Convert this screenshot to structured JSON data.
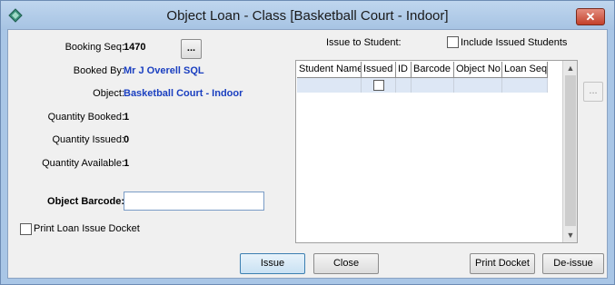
{
  "window": {
    "title": "Object Loan - Class [Basketball Court - Indoor]",
    "close_label": "✕"
  },
  "details": {
    "booking_seq_label": "Booking Seq:",
    "booking_seq_value": "1470",
    "booking_seq_button": "...",
    "booked_by_label": "Booked By:",
    "booked_by_value": "Mr J Overell SQL",
    "object_label": "Object:",
    "object_value": "Basketball Court - Indoor",
    "qty_booked_label": "Quantity Booked:",
    "qty_booked_value": "1",
    "qty_issued_label": "Quantity Issued:",
    "qty_issued_value": "0",
    "qty_available_label": "Quantity Available:",
    "qty_available_value": "1"
  },
  "barcode": {
    "label": "Object Barcode:",
    "value": ""
  },
  "print_docket_checkbox": {
    "label": "Print Loan Issue Docket",
    "checked": false
  },
  "issue_to_student": {
    "label": "Issue to Student:",
    "include_issued_label": "Include Issued Students",
    "include_issued_checked": false,
    "side_button": "...",
    "columns": [
      "Student Name",
      "Issued",
      "ID",
      "Barcode",
      "Object No",
      "Loan Seq"
    ]
  },
  "buttons": {
    "issue": "Issue",
    "close": "Close",
    "print_docket": "Print Docket",
    "de_issue": "De-issue"
  }
}
